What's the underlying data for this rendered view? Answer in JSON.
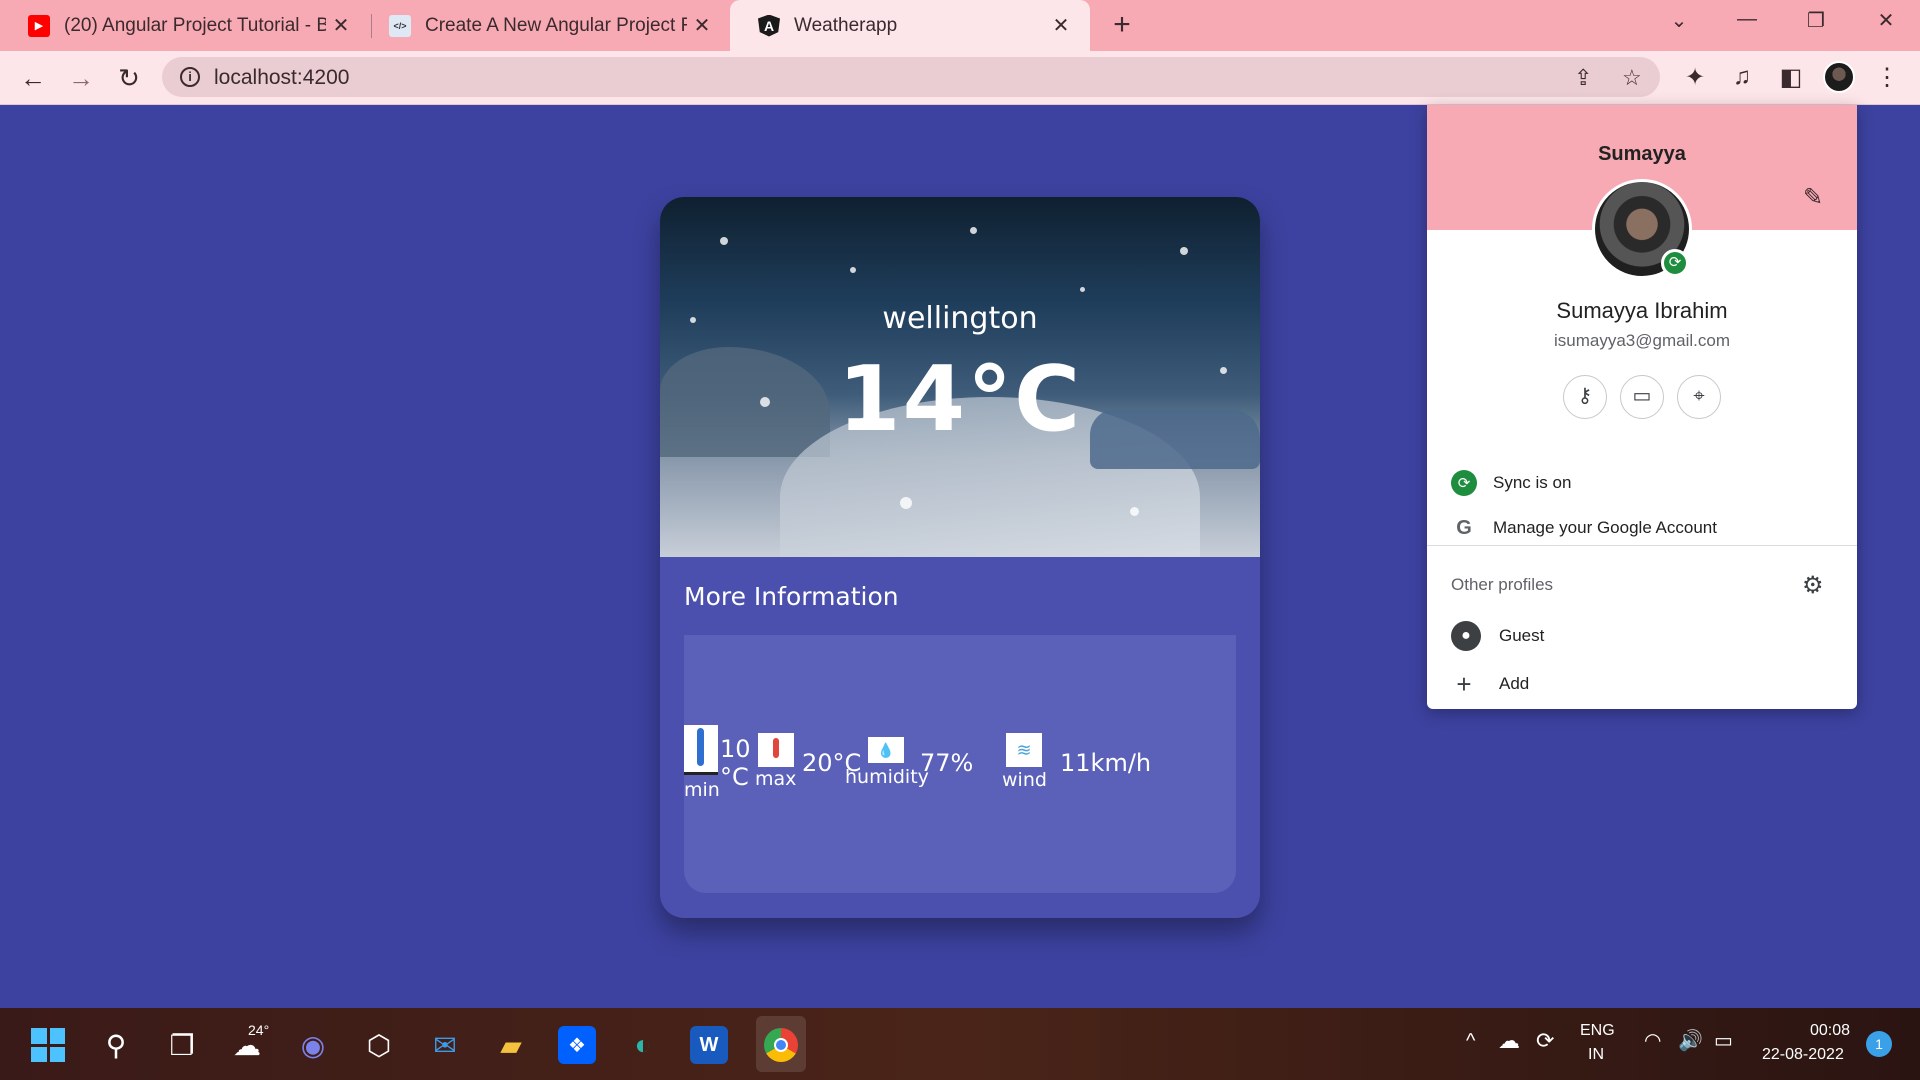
{
  "browser": {
    "tabs": [
      {
        "title": "(20) Angular Project Tutorial - Bu",
        "icon": "youtube-icon"
      },
      {
        "title": "Create A New Angular Project Fro",
        "icon": "code-like-dev-icon"
      },
      {
        "title": "Weatherapp",
        "icon": "angular-icon"
      }
    ],
    "url": "localhost:4200"
  },
  "weather": {
    "city": "wellington",
    "temp": "14°C",
    "more_title": "More Information",
    "min_value": "10",
    "min_unit": "°C",
    "min_label": "min",
    "max_label": "max",
    "max_value": "20°C",
    "humidity_label": "humidity",
    "humidity_value": "77%",
    "wind_label": "wind",
    "wind_value": "11km/h"
  },
  "profile": {
    "name": "Sumayya",
    "full_name": "Sumayya Ibrahim",
    "email": "isumayya3@gmail.com",
    "sync": "Sync is on",
    "manage": "Manage your Google Account",
    "other_profiles": "Other profiles",
    "guest": "Guest",
    "add": "Add"
  },
  "taskbar": {
    "weather_temp": "24°",
    "lang_top": "ENG",
    "lang_bottom": "IN",
    "time": "00:08",
    "date": "22-08-2022",
    "notifications": "1"
  },
  "colors": {
    "page_bg": "#3d42a0",
    "card_bg": "#4b4fad",
    "panel_bg": "#5b60b8",
    "chrome_pink": "#f8aab4",
    "sync_green": "#1e8e3e"
  }
}
